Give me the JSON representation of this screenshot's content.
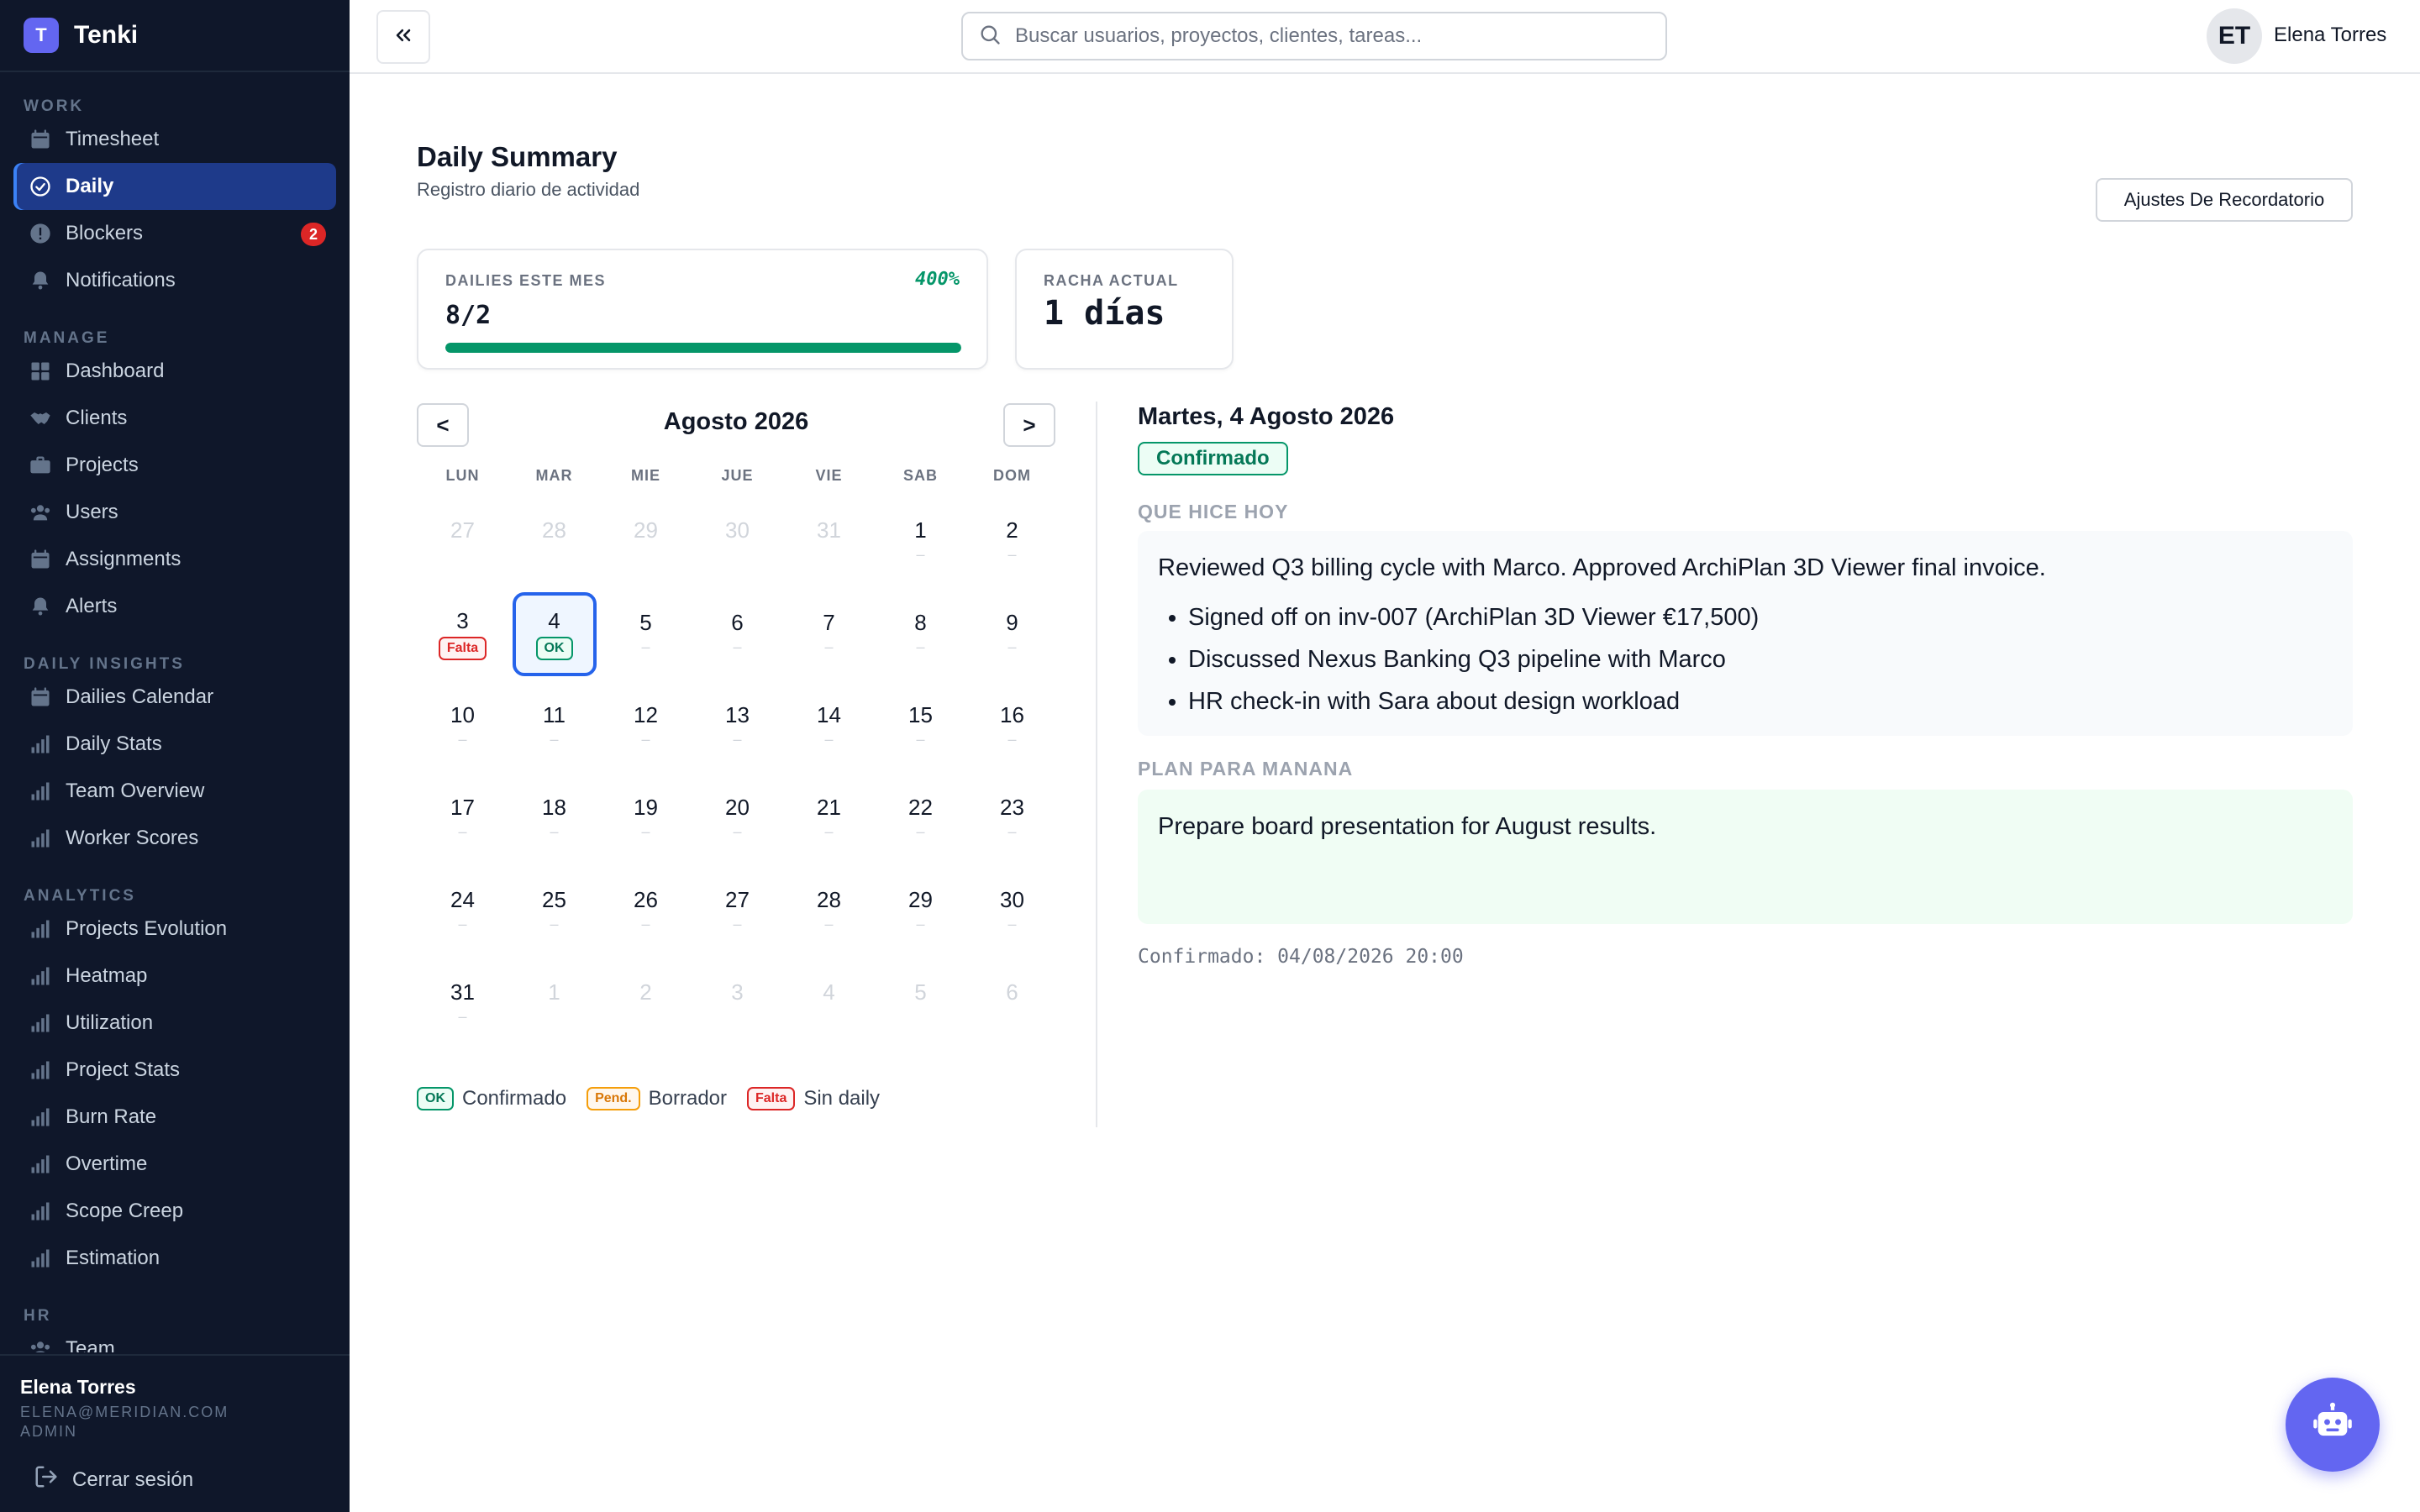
{
  "brand": {
    "logo_letter": "T",
    "name": "Tenki"
  },
  "sidebar": {
    "sections": [
      {
        "title": "WORK",
        "items": [
          {
            "label": "Timesheet",
            "icon": "calendar-icon",
            "active": false
          },
          {
            "label": "Daily",
            "icon": "check-circle-icon",
            "active": true
          },
          {
            "label": "Blockers",
            "icon": "alert-circle-icon",
            "active": false,
            "badge": "2"
          },
          {
            "label": "Notifications",
            "icon": "bell-icon",
            "active": false
          }
        ]
      },
      {
        "title": "MANAGE",
        "items": [
          {
            "label": "Dashboard",
            "icon": "dashboard-icon"
          },
          {
            "label": "Clients",
            "icon": "handshake-icon"
          },
          {
            "label": "Projects",
            "icon": "briefcase-icon"
          },
          {
            "label": "Users",
            "icon": "users-icon"
          },
          {
            "label": "Assignments",
            "icon": "calendar-icon"
          },
          {
            "label": "Alerts",
            "icon": "bell-icon"
          }
        ]
      },
      {
        "title": "DAILY INSIGHTS",
        "items": [
          {
            "label": "Dailies Calendar",
            "icon": "calendar-icon"
          },
          {
            "label": "Daily Stats",
            "icon": "bar-chart-icon"
          },
          {
            "label": "Team Overview",
            "icon": "bar-chart-icon"
          },
          {
            "label": "Worker Scores",
            "icon": "bar-chart-icon"
          }
        ]
      },
      {
        "title": "ANALYTICS",
        "items": [
          {
            "label": "Projects Evolution",
            "icon": "bar-chart-icon"
          },
          {
            "label": "Heatmap",
            "icon": "bar-chart-icon"
          },
          {
            "label": "Utilization",
            "icon": "bar-chart-icon"
          },
          {
            "label": "Project Stats",
            "icon": "bar-chart-icon"
          },
          {
            "label": "Burn Rate",
            "icon": "bar-chart-icon"
          },
          {
            "label": "Overtime",
            "icon": "bar-chart-icon"
          },
          {
            "label": "Scope Creep",
            "icon": "bar-chart-icon"
          },
          {
            "label": "Estimation",
            "icon": "bar-chart-icon"
          }
        ]
      },
      {
        "title": "HR",
        "items": [
          {
            "label": "Team",
            "icon": "users-icon"
          }
        ]
      }
    ],
    "footer": {
      "name": "Elena Torres",
      "email": "ELENA@MERIDIAN.COM",
      "role": "ADMIN",
      "logout_label": "Cerrar sesión"
    }
  },
  "topbar": {
    "search_placeholder": "Buscar usuarios, proyectos, clientes, tareas...",
    "avatar_initials": "ET",
    "user_name": "Elena Torres"
  },
  "header": {
    "title": "Daily Summary",
    "subtitle": "Registro diario de actividad",
    "reminder_button": "Ajustes De Recordatorio"
  },
  "stats": {
    "month": {
      "label": "DAILIES ESTE MES",
      "percent": "400%",
      "value": "8/2",
      "progress": 1.0
    },
    "streak": {
      "label": "RACHA ACTUAL",
      "value": "1 días"
    }
  },
  "calendar": {
    "title": "Agosto 2026",
    "prev_label": "<",
    "next_label": ">",
    "weekdays": [
      "LUN",
      "MAR",
      "MIE",
      "JUE",
      "VIE",
      "SAB",
      "DOM"
    ],
    "weeks": [
      [
        {
          "n": "27",
          "m": true
        },
        {
          "n": "28",
          "m": true
        },
        {
          "n": "29",
          "m": true
        },
        {
          "n": "30",
          "m": true
        },
        {
          "n": "31",
          "m": true
        },
        {
          "n": "1",
          "dash": "–"
        },
        {
          "n": "2",
          "dash": "–"
        }
      ],
      [
        {
          "n": "3",
          "badge": "falta",
          "badge_label": "Falta"
        },
        {
          "n": "4",
          "badge": "ok",
          "badge_label": "OK",
          "selected": true
        },
        {
          "n": "5",
          "dash": "–"
        },
        {
          "n": "6",
          "dash": "–"
        },
        {
          "n": "7",
          "dash": "–"
        },
        {
          "n": "8",
          "dash": "–"
        },
        {
          "n": "9",
          "dash": "–"
        }
      ],
      [
        {
          "n": "10",
          "dash": "–"
        },
        {
          "n": "11",
          "dash": "–"
        },
        {
          "n": "12",
          "dash": "–"
        },
        {
          "n": "13",
          "dash": "–"
        },
        {
          "n": "14",
          "dash": "–"
        },
        {
          "n": "15",
          "dash": "–"
        },
        {
          "n": "16",
          "dash": "–"
        }
      ],
      [
        {
          "n": "17",
          "dash": "–"
        },
        {
          "n": "18",
          "dash": "–"
        },
        {
          "n": "19",
          "dash": "–"
        },
        {
          "n": "20",
          "dash": "–"
        },
        {
          "n": "21",
          "dash": "–"
        },
        {
          "n": "22",
          "dash": "–"
        },
        {
          "n": "23",
          "dash": "–"
        }
      ],
      [
        {
          "n": "24",
          "dash": "–"
        },
        {
          "n": "25",
          "dash": "–"
        },
        {
          "n": "26",
          "dash": "–"
        },
        {
          "n": "27",
          "dash": "–"
        },
        {
          "n": "28",
          "dash": "–"
        },
        {
          "n": "29",
          "dash": "–"
        },
        {
          "n": "30",
          "dash": "–"
        }
      ],
      [
        {
          "n": "31",
          "dash": "–"
        },
        {
          "n": "1",
          "m": true
        },
        {
          "n": "2",
          "m": true
        },
        {
          "n": "3",
          "m": true
        },
        {
          "n": "4",
          "m": true
        },
        {
          "n": "5",
          "m": true
        },
        {
          "n": "6",
          "m": true
        }
      ]
    ],
    "legend": [
      {
        "badge": "ok",
        "badge_label": "OK",
        "label": "Confirmado"
      },
      {
        "badge": "pend",
        "badge_label": "Pend.",
        "label": "Borrador"
      },
      {
        "badge": "falta",
        "badge_label": "Falta",
        "label": "Sin daily"
      }
    ]
  },
  "detail": {
    "date": "Martes, 4 Agosto 2026",
    "status": "Confirmado",
    "today_label": "QUE HICE HOY",
    "today_text": "Reviewed Q3 billing cycle with Marco. Approved ArchiPlan 3D Viewer final invoice.",
    "today_bullets": [
      "Signed off on inv-007 (ArchiPlan 3D Viewer €17,500)",
      "Discussed Nexus Banking Q3 pipeline with Marco",
      "HR check-in with Sara about design workload"
    ],
    "plan_label": "PLAN PARA MANANA",
    "plan_text": "Prepare board presentation for August results.",
    "confirmed_at": "Confirmado: 04/08/2026 20:00"
  },
  "colors": {
    "sidebar_bg": "#0f172a",
    "accent": "#6366f1",
    "active_blue": "#2563eb",
    "success": "#059669",
    "danger": "#dc2626",
    "warning": "#f59e0b"
  },
  "fab": {
    "icon": "robot-icon"
  }
}
